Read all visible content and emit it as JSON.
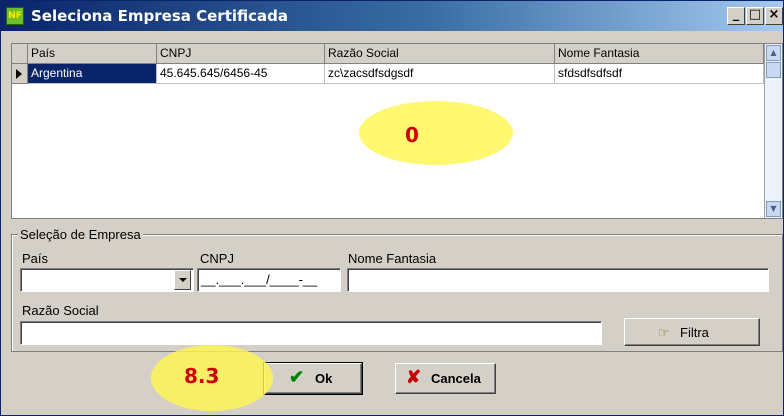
{
  "window": {
    "title": "Seleciona Empresa Certificada",
    "controls": {
      "minimize": "_",
      "maximize": "□",
      "close": "×"
    }
  },
  "grid": {
    "columns": [
      "País",
      "CNPJ",
      "Razão Social",
      "Nome Fantasia"
    ],
    "rows": [
      {
        "pais": "Argentina",
        "cnpj": "45.645.645/6456-45",
        "razao_social": "zc\\zacsdfsdgsdf",
        "nome_fantasia": "sfdsdfsdfsdf"
      }
    ],
    "selected_row": 0
  },
  "filter_group": {
    "title": "Seleção de Empresa",
    "pais_label": "País",
    "pais_value": "",
    "cnpj_label": "CNPJ",
    "cnpj_mask": "__.___.___/____-__",
    "nome_fantasia_label": "Nome Fantasia",
    "nome_fantasia_value": "",
    "razao_social_label": "Razão Social",
    "razao_social_value": "",
    "filter_button": "Filtra"
  },
  "buttons": {
    "ok": "Ok",
    "cancel": "Cancela"
  },
  "annotations": {
    "grid_marker": "0",
    "ok_marker": "8.3"
  },
  "colors": {
    "selection": "#0a246a",
    "title_bar": "#0a246a",
    "highlight": "#fff750",
    "marker_text": "#d00000"
  },
  "icons": [
    "app-icon",
    "row-indicator-icon",
    "scroll-up-icon",
    "scroll-down-icon",
    "dropdown-arrow-icon",
    "filter-icon",
    "checkmark-icon",
    "x-icon"
  ]
}
